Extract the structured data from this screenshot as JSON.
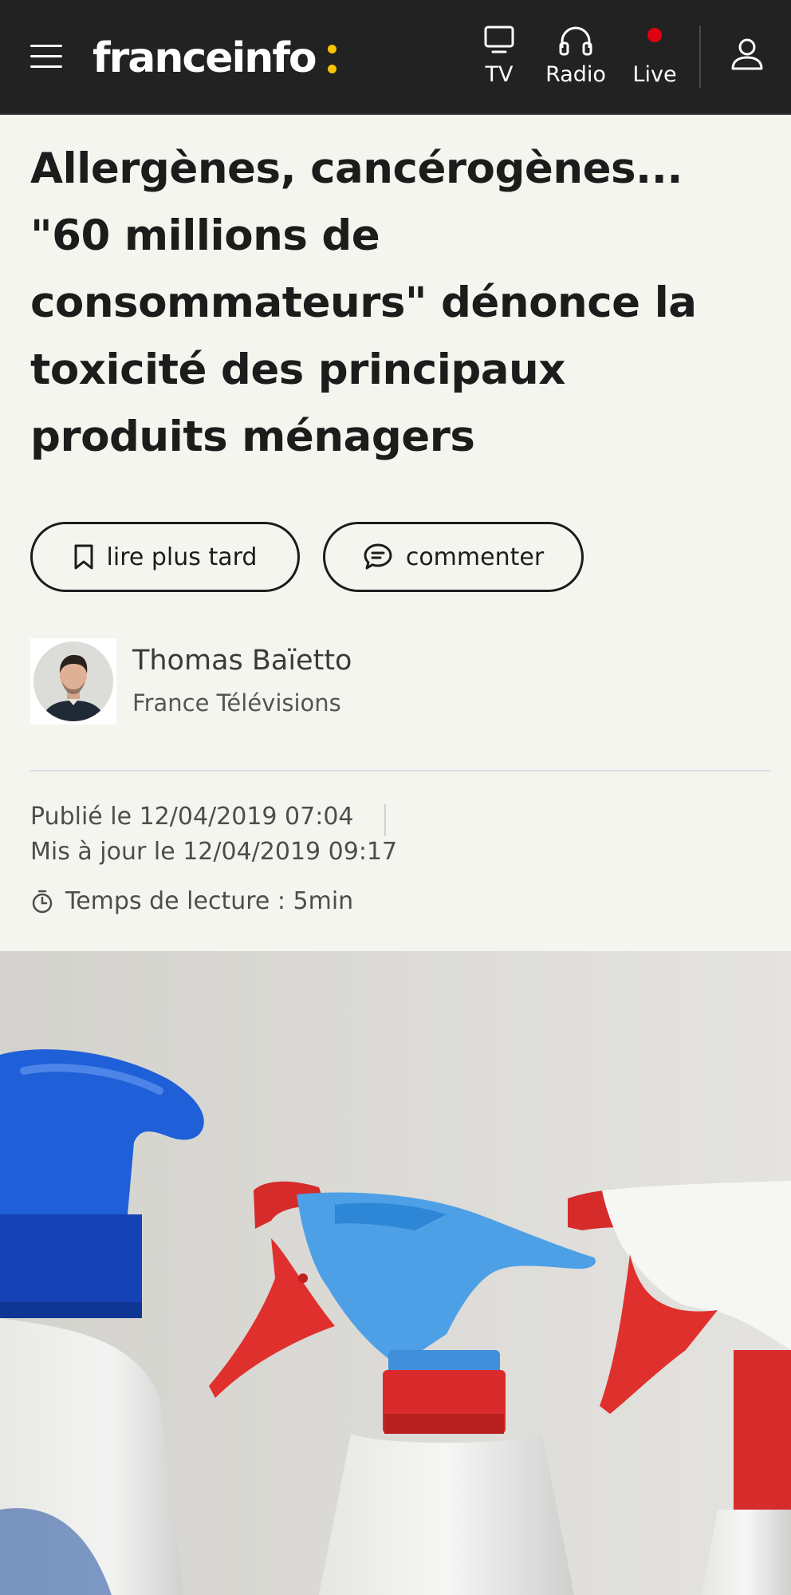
{
  "header": {
    "logo": "franceinfo",
    "nav": [
      {
        "label": "TV",
        "icon": "tv-icon"
      },
      {
        "label": "Radio",
        "icon": "headphones-icon"
      },
      {
        "label": "Live",
        "icon": "live-dot-icon"
      }
    ],
    "account_icon": "user-icon",
    "menu_icon": "hamburger-menu-icon",
    "colors": {
      "bar": "#222222",
      "logo_accent": "#f8c300",
      "live": "#e1000f"
    }
  },
  "article": {
    "title_lines": [
      "Allergènes, cancérogènes...",
      "\"60 millions de",
      "consommateurs\" dénonce la",
      "toxicité des principaux",
      "produits ménagers"
    ],
    "actions": {
      "read_later": "lire plus tard",
      "comment": "commenter"
    },
    "author": {
      "name": "Thomas Baïetto",
      "organization": "France Télévisions"
    },
    "published": "Publié le 12/04/2019 07:04",
    "updated": "Mis à jour le 12/04/2019 09:17",
    "reading_time": "Temps de lecture : 5min"
  }
}
